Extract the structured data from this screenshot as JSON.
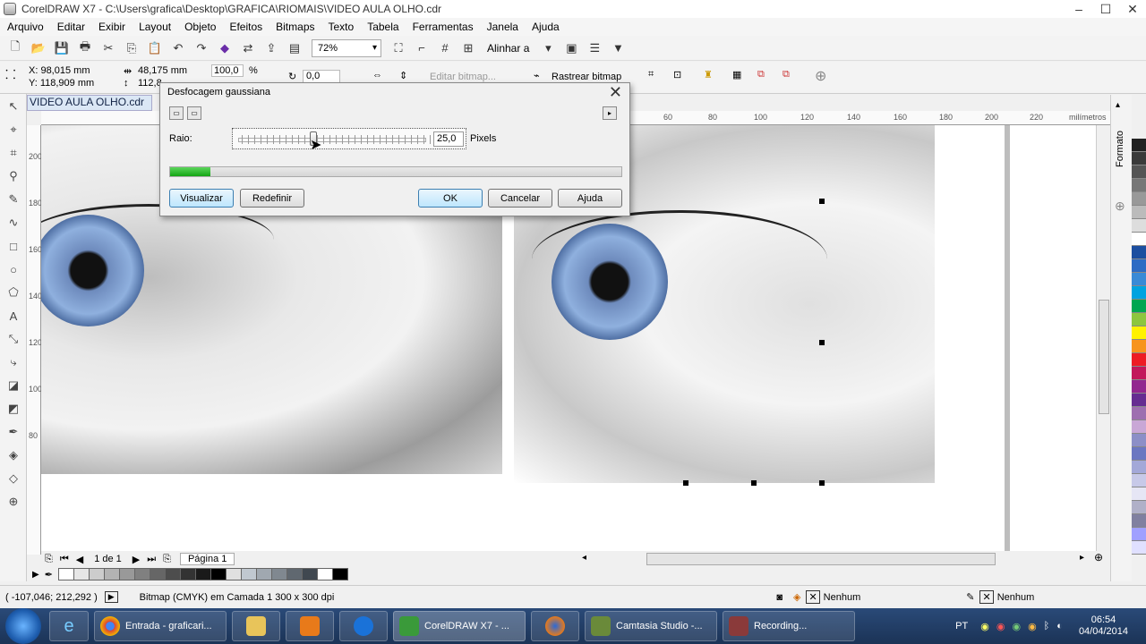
{
  "window": {
    "title": "CorelDRAW X7 - C:\\Users\\grafica\\Desktop\\GRAFICA\\RIOMAIS\\VIDEO AULA OLHO.cdr",
    "minimize": "–",
    "maximize": "☐",
    "close": "✕"
  },
  "menu": [
    "Arquivo",
    "Editar",
    "Exibir",
    "Layout",
    "Objeto",
    "Efeitos",
    "Bitmaps",
    "Texto",
    "Tabela",
    "Ferramentas",
    "Janela",
    "Ajuda"
  ],
  "toolbar": {
    "zoom": "72%",
    "align_label": "Alinhar a"
  },
  "propbar": {
    "x": "X: 98,015 mm",
    "y": "Y: 118,909 mm",
    "width": "48,175 mm",
    "height": "112,8",
    "scale_w": "100,0",
    "scale_pct": "%",
    "rotation": "0,0",
    "edit_bitmap": "Editar bitmap...",
    "trace_bitmap": "Rastrear bitmap"
  },
  "document": {
    "tab": "VIDEO AULA OLHO.cdr",
    "ruler_unit": "milímetros",
    "ruler_h_labels": [
      "60",
      "80",
      "100",
      "120",
      "140",
      "160",
      "180",
      "200",
      "220"
    ],
    "ruler_v_labels": [
      "200",
      "180",
      "160",
      "140",
      "120",
      "100",
      "80"
    ]
  },
  "dialog": {
    "title": "Desfocagem gaussiana",
    "radius_label": "Raio:",
    "radius_value": "25,0",
    "unit": "Pixels",
    "slider_fraction": 0.4,
    "progress_fraction": 0.09,
    "preview_button": "Visualizar",
    "reset_button": "Redefinir",
    "ok_button": "OK",
    "cancel_button": "Cancelar",
    "help_button": "Ajuda"
  },
  "docker": {
    "label": "Formato"
  },
  "pagenav": {
    "page_count": "1 de 1",
    "page_tab": "Página 1"
  },
  "status": {
    "coords": "( -107,046; 212,292 )",
    "info": "Bitmap (CMYK) em Camada 1 300 x 300 dpi",
    "fill": "Nenhum",
    "outline": "Nenhum"
  },
  "taskbar": {
    "items": [
      "Entrada - graficari...",
      "CorelDRAW X7 - ...",
      "Camtasia Studio -...",
      "Recording..."
    ],
    "lang": "PT",
    "time": "06:54",
    "date": "04/04/2014"
  },
  "colors": {
    "accent": "#3c7fb1",
    "progress": "#13a513",
    "taskbar": "#1b3356"
  },
  "palette": [
    "#222222",
    "#3a3a3a",
    "#555555",
    "#777777",
    "#999999",
    "#bbbbbb",
    "#dddddd",
    "#ffffff",
    "#1d4fa0",
    "#2d6bc4",
    "#3a8ad6",
    "#00a3e0",
    "#00a651",
    "#8dc63f",
    "#fff200",
    "#f7941d",
    "#ed1c24",
    "#c2185b",
    "#92278f",
    "#662d91",
    "#9e6fb0",
    "#c9a7d6",
    "#8c8fc7",
    "#6b77c1",
    "#a3a8d8",
    "#c7c9e8",
    "#e6e6f5",
    "#b0b0c8",
    "#8080a0",
    "#a0a0ff",
    "#e0e0ff"
  ],
  "swatches": [
    "#ffffff",
    "#e6e6e6",
    "#cccccc",
    "#b3b3b3",
    "#999999",
    "#808080",
    "#666666",
    "#4d4d4d",
    "#333333",
    "#1a1a1a",
    "#000000",
    "#e0e0e0",
    "#c0c8d0",
    "#a0a8b0",
    "#808890",
    "#606870",
    "#404850",
    "#ffffff",
    "#000000"
  ]
}
